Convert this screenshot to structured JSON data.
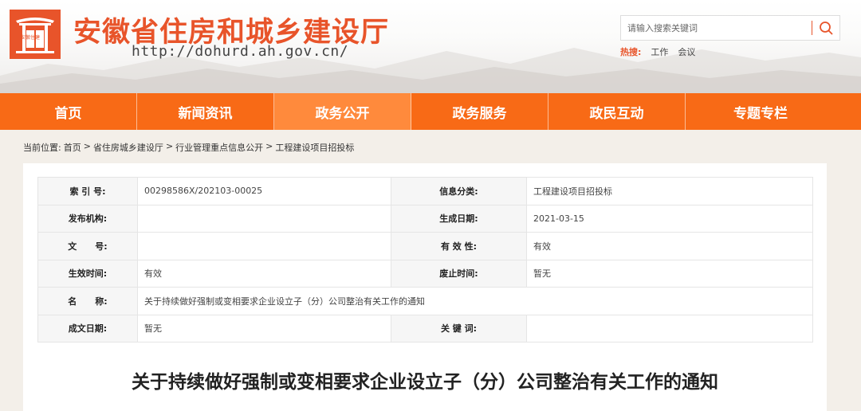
{
  "header": {
    "logo_text": "安徽住建",
    "site_title": "安徽省住房和城乡建设厅",
    "site_url": "http://dohurd.ah.gov.cn/",
    "search": {
      "placeholder": "请输入搜索关键词"
    },
    "hot": {
      "label": "热搜:",
      "items": [
        "工作",
        "会议"
      ]
    }
  },
  "nav": {
    "items": [
      {
        "label": "首页"
      },
      {
        "label": "新闻资讯"
      },
      {
        "label": "政务公开"
      },
      {
        "label": "政务服务"
      },
      {
        "label": "政民互动"
      },
      {
        "label": "专题专栏"
      }
    ]
  },
  "breadcrumb": {
    "prefix": "当前位置:",
    "items": [
      "首页",
      "省住房城乡建设厅",
      "行业管理重点信息公开",
      "工程建设项目招投标"
    ],
    "separator": ">"
  },
  "info": {
    "index_label": "索 引 号:",
    "index_value": "00298586X/202103-00025",
    "category_label": "信息分类:",
    "category_value": "工程建设项目招投标",
    "publisher_label": "发布机构:",
    "publisher_value": "",
    "gen_date_label": "生成日期:",
    "gen_date_value": "2021-03-15",
    "doc_no_label": "文      号:",
    "doc_no_value": "",
    "validity_label": "有 效 性:",
    "validity_value": "有效",
    "effective_label": "生效时间:",
    "effective_value": "有效",
    "abolish_label": "废止时间:",
    "abolish_value": "暂无",
    "name_label": "名      称:",
    "name_value": "关于持续做好强制或变相要求企业设立子（分）公司整治有关工作的通知",
    "written_label": "成文日期:",
    "written_value": "暂无",
    "keywords_label": "关 键 词:",
    "keywords_value": ""
  },
  "document": {
    "title": "关于持续做好强制或变相要求企业设立子（分）公司整治有关工作的通知"
  },
  "colors": {
    "accent": "#f86a16",
    "brand": "#e8542a",
    "nav_active": "#ff8a3c"
  }
}
